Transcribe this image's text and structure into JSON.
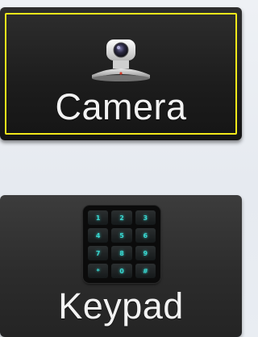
{
  "tiles": {
    "camera": {
      "label": "Camera",
      "icon": "camera-icon",
      "selected": true,
      "highlight_color": "#f2e81a"
    },
    "keypad": {
      "label": "Keypad",
      "icon": "keypad-icon",
      "keys": [
        "1",
        "2",
        "3",
        "4",
        "5",
        "6",
        "7",
        "8",
        "9",
        "*",
        "0",
        "#"
      ],
      "key_color": "#38d7d0"
    }
  }
}
